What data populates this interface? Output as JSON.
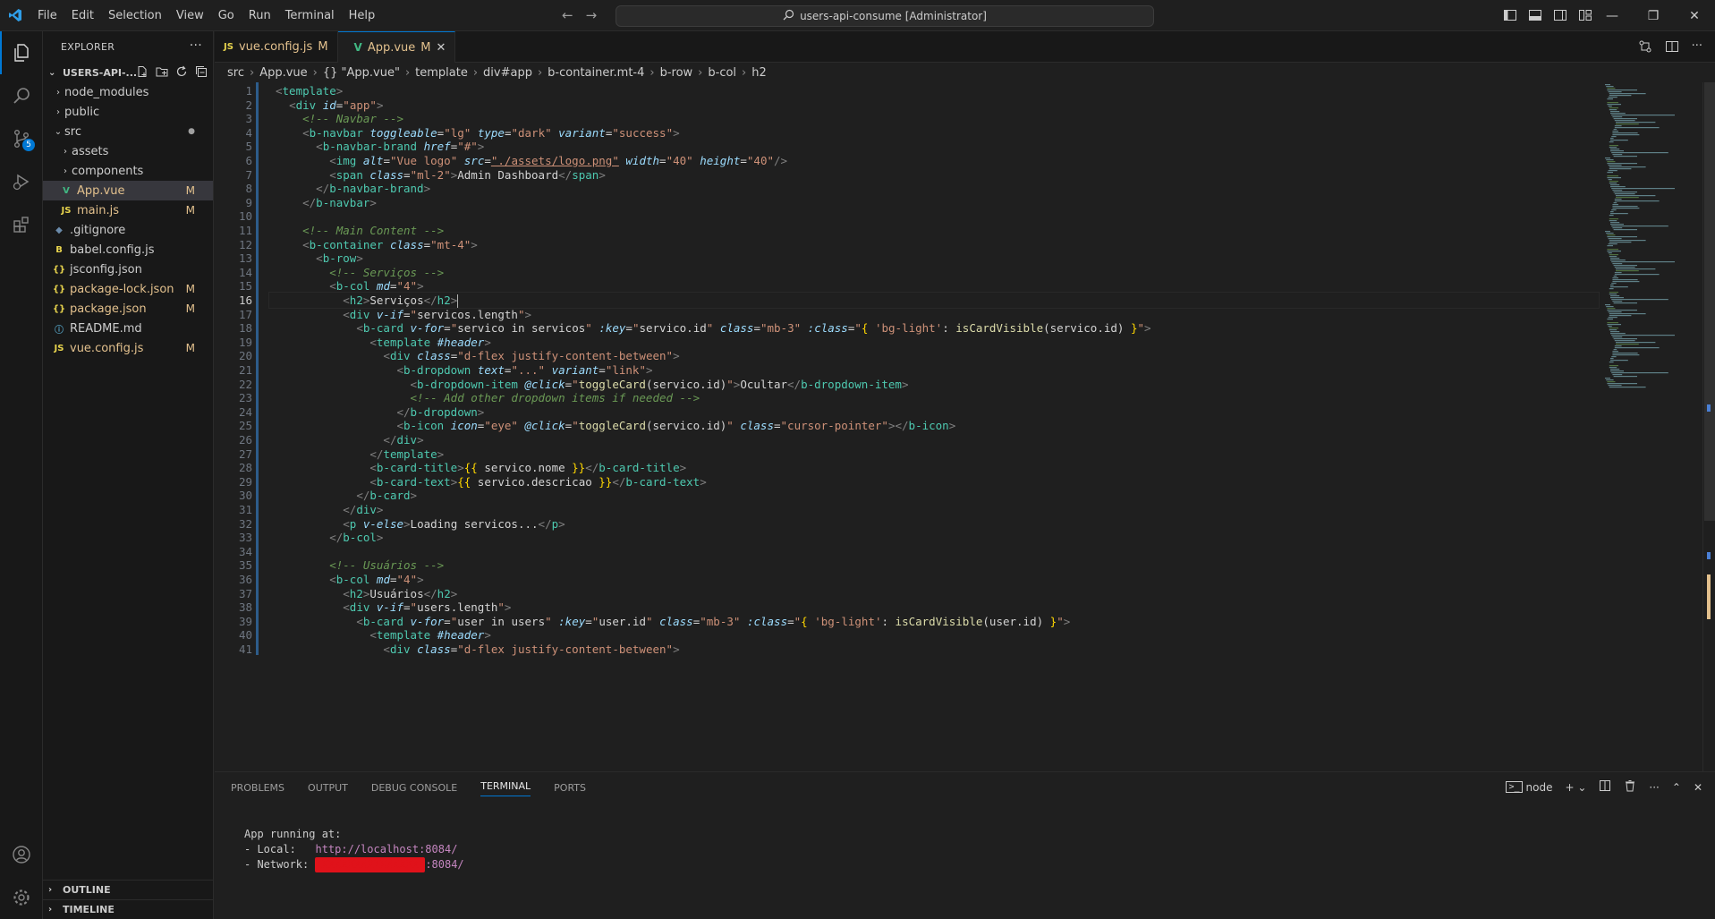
{
  "titlebar": {
    "menu": [
      "File",
      "Edit",
      "Selection",
      "View",
      "Go",
      "Run",
      "Terminal",
      "Help"
    ],
    "command_center": "users-api-consume [Administrator]"
  },
  "activity": {
    "scm_badge": "5"
  },
  "explorer": {
    "header": "EXPLORER",
    "folder": "USERS-API-...",
    "items": [
      {
        "label": "node_modules",
        "kind": "folder",
        "status": ""
      },
      {
        "label": "public",
        "kind": "folder",
        "status": ""
      },
      {
        "label": "src",
        "kind": "folder-open",
        "status": "●"
      },
      {
        "label": "assets",
        "kind": "folder",
        "status": ""
      },
      {
        "label": "components",
        "kind": "folder",
        "status": ""
      },
      {
        "label": "App.vue",
        "kind": "vue",
        "status": "M"
      },
      {
        "label": "main.js",
        "kind": "js",
        "status": "M"
      },
      {
        "label": ".gitignore",
        "kind": "git",
        "status": ""
      },
      {
        "label": "babel.config.js",
        "kind": "babel",
        "status": ""
      },
      {
        "label": "jsconfig.json",
        "kind": "json",
        "status": ""
      },
      {
        "label": "package-lock.json",
        "kind": "json",
        "status": "M"
      },
      {
        "label": "package.json",
        "kind": "json",
        "status": "M"
      },
      {
        "label": "README.md",
        "kind": "info",
        "status": ""
      },
      {
        "label": "vue.config.js",
        "kind": "js",
        "status": "M"
      }
    ],
    "outline": "OUTLINE",
    "timeline": "TIMELINE"
  },
  "tabs": [
    {
      "label": "vue.config.js",
      "icon": "JS",
      "status": "M"
    },
    {
      "label": "App.vue",
      "icon": "V",
      "status": "M"
    }
  ],
  "breadcrumbs": [
    "src",
    "App.vue",
    "{} \"App.vue\"",
    "template",
    "div#app",
    "b-container.mt-4",
    "b-row",
    "b-col",
    "h2"
  ],
  "editor": {
    "current_line": 16,
    "lines": [
      "<template>",
      "  <div id=\"app\">",
      "    <!-- Navbar -->",
      "    <b-navbar toggleable=\"lg\" type=\"dark\" variant=\"success\">",
      "      <b-navbar-brand href=\"#\">",
      "        <img alt=\"Vue logo\" src=\"./assets/logo.png\" width=\"40\" height=\"40\"/>",
      "        <span class=\"ml-2\">Admin Dashboard</span>",
      "      </b-navbar-brand>",
      "    </b-navbar>",
      "",
      "    <!-- Main Content -->",
      "    <b-container class=\"mt-4\">",
      "      <b-row>",
      "        <!-- Serviços -->",
      "        <b-col md=\"4\">",
      "          <h2>Serviços</h2>",
      "          <div v-if=\"servicos.length\">",
      "            <b-card v-for=\"servico in servicos\" :key=\"servico.id\" class=\"mb-3\" :class=\"{ 'bg-light': isCardVisible(servico.id) }\">",
      "              <template #header>",
      "                <div class=\"d-flex justify-content-between\">",
      "                  <b-dropdown text=\"...\" variant=\"link\">",
      "                    <b-dropdown-item @click=\"toggleCard(servico.id)\">Ocultar</b-dropdown-item>",
      "                    <!-- Add other dropdown items if needed -->",
      "                  </b-dropdown>",
      "                  <b-icon icon=\"eye\" @click=\"toggleCard(servico.id)\" class=\"cursor-pointer\"></b-icon>",
      "                </div>",
      "              </template>",
      "              <b-card-title>{{ servico.nome }}</b-card-title>",
      "              <b-card-text>{{ servico.descricao }}</b-card-text>",
      "            </b-card>",
      "          </div>",
      "          <p v-else>Loading servicos...</p>",
      "        </b-col>",
      "",
      "        <!-- Usuários -->",
      "        <b-col md=\"4\">",
      "          <h2>Usuários</h2>",
      "          <div v-if=\"users.length\">",
      "            <b-card v-for=\"user in users\" :key=\"user.id\" class=\"mb-3\" :class=\"{ 'bg-light': isCardVisible(user.id) }\">",
      "              <template #header>",
      "                <div class=\"d-flex justify-content-between\">"
    ]
  },
  "panel": {
    "tabs": [
      "PROBLEMS",
      "OUTPUT",
      "DEBUG CONSOLE",
      "TERMINAL",
      "PORTS"
    ],
    "active_tab": "TERMINAL",
    "shell": "node",
    "terminal": {
      "line1": "App running at:",
      "local_label": "- Local:   ",
      "local_url": "http://localhost:8084/",
      "network_label": "- Network: ",
      "network_suffix": ":8084/"
    }
  },
  "colors": {
    "accent": "#0078d4",
    "modified": "#e2c08d",
    "redaction": "#e0121a"
  }
}
